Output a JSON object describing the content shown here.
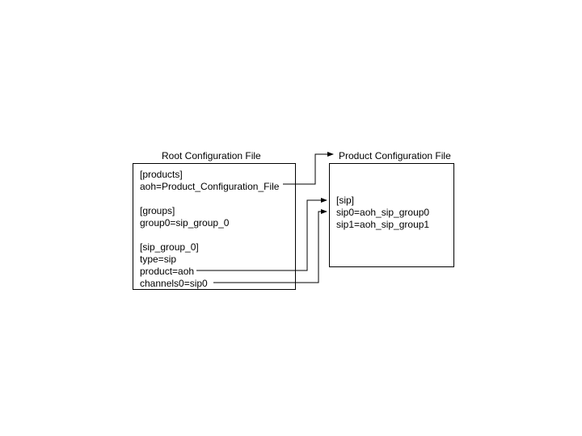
{
  "left": {
    "title": "Root Configuration File",
    "sections": {
      "products": {
        "header": "[products]",
        "line1": "aoh=Product_Configuration_File"
      },
      "groups": {
        "header": "[groups]",
        "line1": "group0=sip_group_0"
      },
      "sip_group_0": {
        "header": "[sip_group_0]",
        "type": "type=sip",
        "product": "product=aoh",
        "channels": "channels0=sip0"
      }
    }
  },
  "right": {
    "title": "Product Configuration File",
    "section": {
      "header": "[sip]",
      "line1": "sip0=aoh_sip_group0",
      "line2": "sip1=aoh_sip_group1"
    }
  }
}
